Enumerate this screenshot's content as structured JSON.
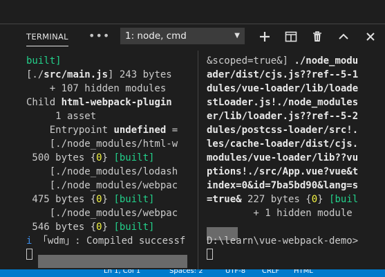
{
  "panel": {
    "title": "TERMINAL",
    "more_label": "•••",
    "dropdown": {
      "selected": "1: node, cmd",
      "caret": "▼"
    },
    "toolbar": [
      "plus-icon",
      "split-icon",
      "trash-icon",
      "chevron-up-icon",
      "close-icon"
    ]
  },
  "left_terminal": {
    "lines": [
      [
        {
          "t": "built]",
          "c": "g"
        }
      ],
      [
        {
          "t": "[./"
        },
        {
          "t": "src/main.js",
          "c": "b"
        },
        {
          "t": "] 243 bytes "
        }
      ],
      [
        {
          "t": "    + 107 hidden modules"
        }
      ],
      [
        {
          "t": "Child "
        },
        {
          "t": "html-webpack-plugin",
          "c": "b"
        }
      ],
      [
        {
          "t": "     1 asset"
        }
      ],
      [
        {
          "t": "    Entrypoint "
        },
        {
          "t": "undefined",
          "c": "b"
        },
        {
          "t": " ="
        }
      ],
      [
        {
          "t": "    [./node_modules/html-w"
        }
      ],
      [
        {
          "t": " 500 bytes {"
        },
        {
          "t": "0",
          "c": "y"
        },
        {
          "t": "} "
        },
        {
          "t": "[built]",
          "c": "g"
        }
      ],
      [
        {
          "t": "    [./node_modules/lodash"
        }
      ],
      [
        {
          "t": "    [./node_modules/webpac"
        }
      ],
      [
        {
          "t": " 475 bytes {"
        },
        {
          "t": "0",
          "c": "y"
        },
        {
          "t": "} "
        },
        {
          "t": "[built]",
          "c": "g"
        }
      ],
      [
        {
          "t": "    [./node_modules/webpac"
        }
      ],
      [
        {
          "t": " 546 bytes {"
        },
        {
          "t": "0",
          "c": "y"
        },
        {
          "t": "} "
        },
        {
          "t": "[built]",
          "c": "g"
        }
      ],
      [
        {
          "t": "i",
          "c": "c"
        },
        {
          "t": " 「wdm」: Compiled successf"
        }
      ],
      [
        {
          "t": "",
          "cursor": true
        }
      ]
    ]
  },
  "right_terminal": {
    "lines": [
      [
        {
          "t": "&scoped=true&] "
        },
        {
          "t": "./node_modu",
          "c": "b"
        }
      ],
      [
        {
          "t": "ader/dist/cjs.js??ref--5-1",
          "c": "b"
        }
      ],
      [
        {
          "t": "dules/vue-loader/lib/loade",
          "c": "b"
        }
      ],
      [
        {
          "t": "stLoader.js!./node_modules",
          "c": "b"
        }
      ],
      [
        {
          "t": "er/lib/loader.js??ref--5-2",
          "c": "b"
        }
      ],
      [
        {
          "t": "dules/postcss-loader/src!.",
          "c": "b"
        }
      ],
      [
        {
          "t": "les/cache-loader/dist/cjs.",
          "c": "b"
        }
      ],
      [
        {
          "t": "modules/vue-loader/lib??vu",
          "c": "b"
        }
      ],
      [
        {
          "t": "ptions!./src/App.vue?vue&t",
          "c": "b"
        }
      ],
      [
        {
          "t": "index=0&id=7ba5bd90&lang=s",
          "c": "b"
        }
      ],
      [
        {
          "t": "=true&",
          "c": "b"
        },
        {
          "t": " 227 bytes {"
        },
        {
          "t": "0",
          "c": "y"
        },
        {
          "t": "} "
        },
        {
          "t": "[buil",
          "c": "g"
        }
      ],
      [
        {
          "t": "        + 1 hidden module"
        }
      ],
      [
        {
          "t": ""
        }
      ],
      [
        {
          "t": "D:\\learn\\vue-webpack-demo>"
        }
      ],
      [
        {
          "t": "",
          "cursor": true
        }
      ]
    ]
  },
  "status_bar": {
    "color": "#007acc",
    "fragments": [
      "Ln 1, Col 1",
      "Spaces: 2",
      "UTF-8",
      "CRLF",
      "HTML"
    ]
  },
  "colors": {
    "background": "#1e1e1e",
    "green": "#23d18b",
    "yellow": "#f5f543",
    "blue": "#3b8eea"
  }
}
